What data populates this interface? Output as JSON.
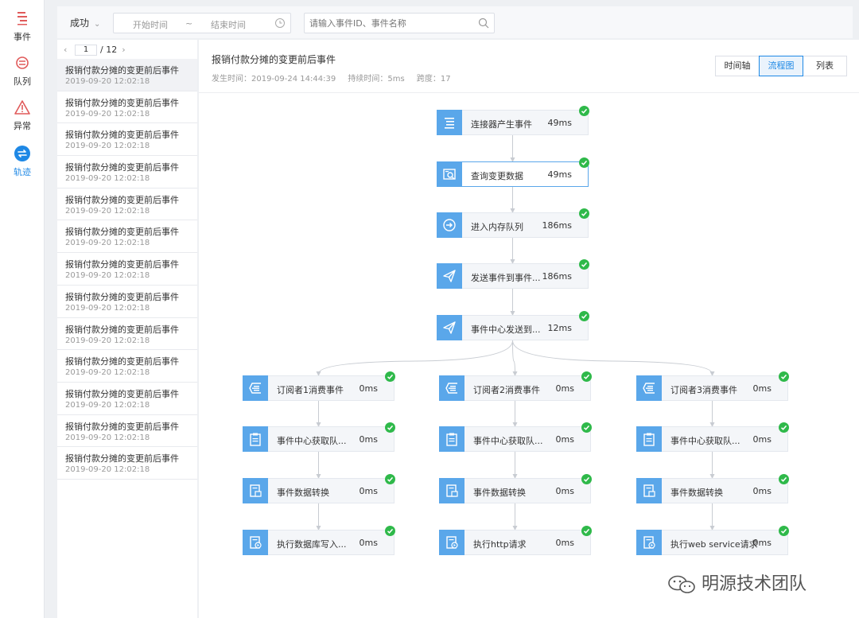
{
  "nav": {
    "items": [
      {
        "label": "事件",
        "icon": "event-icon",
        "color": "#e05a5a"
      },
      {
        "label": "队列",
        "icon": "queue-icon",
        "color": "#e05a5a"
      },
      {
        "label": "异常",
        "icon": "warning-icon",
        "color": "#e05a5a"
      },
      {
        "label": "轨迹",
        "icon": "trace-icon",
        "color": "#1e88e5"
      }
    ],
    "active_index": 3
  },
  "filters": {
    "status": "成功",
    "start_placeholder": "开始时间",
    "range_separator": "~",
    "end_placeholder": "结束时间",
    "search_placeholder": "请输入事件ID、事件名称"
  },
  "pager": {
    "current": "1",
    "total": "/ 12"
  },
  "list": {
    "items": [
      {
        "title": "报销付款分摊的变更前后事件",
        "time": "2019-09-20 12:02:18"
      },
      {
        "title": "报销付款分摊的变更前后事件",
        "time": "2019-09-20 12:02:18"
      },
      {
        "title": "报销付款分摊的变更前后事件",
        "time": "2019-09-20 12:02:18"
      },
      {
        "title": "报销付款分摊的变更前后事件",
        "time": "2019-09-20 12:02:18"
      },
      {
        "title": "报销付款分摊的变更前后事件",
        "time": "2019-09-20 12:02:18"
      },
      {
        "title": "报销付款分摊的变更前后事件",
        "time": "2019-09-20 12:02:18"
      },
      {
        "title": "报销付款分摊的变更前后事件",
        "time": "2019-09-20 12:02:18"
      },
      {
        "title": "报销付款分摊的变更前后事件",
        "time": "2019-09-20 12:02:18"
      },
      {
        "title": "报销付款分摊的变更前后事件",
        "time": "2019-09-20 12:02:18"
      },
      {
        "title": "报销付款分摊的变更前后事件",
        "time": "2019-09-20 12:02:18"
      },
      {
        "title": "报销付款分摊的变更前后事件",
        "time": "2019-09-20 12:02:18"
      },
      {
        "title": "报销付款分摊的变更前后事件",
        "time": "2019-09-20 12:02:18"
      },
      {
        "title": "报销付款分摊的变更前后事件",
        "time": "2019-09-20 12:02:18"
      }
    ]
  },
  "detail": {
    "title": "报销付款分摊的变更前后事件",
    "occurred": "发生时间：2019-09-24 14:44:39",
    "duration": "持续时间：5ms",
    "span": "跨度：17"
  },
  "view_tabs": [
    {
      "label": "时间轴"
    },
    {
      "label": "流程图"
    },
    {
      "label": "列表"
    }
  ],
  "active_view": 1,
  "flow": {
    "main": [
      {
        "label": "连接器产生事件",
        "time": "49ms",
        "icon": "connector-icon"
      },
      {
        "label": "查询变更数据",
        "time": "49ms",
        "icon": "query-icon"
      },
      {
        "label": "进入内存队列",
        "time": "186ms",
        "icon": "enter-icon"
      },
      {
        "label": "发送事件到事件...",
        "time": "186ms",
        "icon": "send-icon"
      },
      {
        "label": "事件中心发送到...",
        "time": "12ms",
        "icon": "send-icon"
      }
    ],
    "branches": [
      [
        {
          "label": "订阅者1消费事件",
          "time": "0ms",
          "icon": "consume-icon"
        },
        {
          "label": "事件中心获取队...",
          "time": "0ms",
          "icon": "clipboard-icon"
        },
        {
          "label": "事件数据转换",
          "time": "0ms",
          "icon": "transform-icon"
        },
        {
          "label": "执行数据库写入...",
          "time": "0ms",
          "icon": "execute-icon"
        }
      ],
      [
        {
          "label": "订阅者2消费事件",
          "time": "0ms",
          "icon": "consume-icon"
        },
        {
          "label": "事件中心获取队...",
          "time": "0ms",
          "icon": "clipboard-icon"
        },
        {
          "label": "事件数据转换",
          "time": "0ms",
          "icon": "transform-icon"
        },
        {
          "label": "执行http请求",
          "time": "0ms",
          "icon": "execute-icon"
        }
      ],
      [
        {
          "label": "订阅者3消费事件",
          "time": "0ms",
          "icon": "consume-icon"
        },
        {
          "label": "事件中心获取队...",
          "time": "0ms",
          "icon": "clipboard-icon"
        },
        {
          "label": "事件数据转换",
          "time": "0ms",
          "icon": "transform-icon"
        },
        {
          "label": "执行web service请求",
          "time": "0ms",
          "icon": "execute-icon"
        }
      ]
    ],
    "selected": "main.1"
  },
  "colors": {
    "accent": "#1e88e5",
    "node_icon_bg": "#5aa7ea",
    "success": "#2fb94a"
  },
  "watermark": {
    "text": "明源技术团队"
  }
}
